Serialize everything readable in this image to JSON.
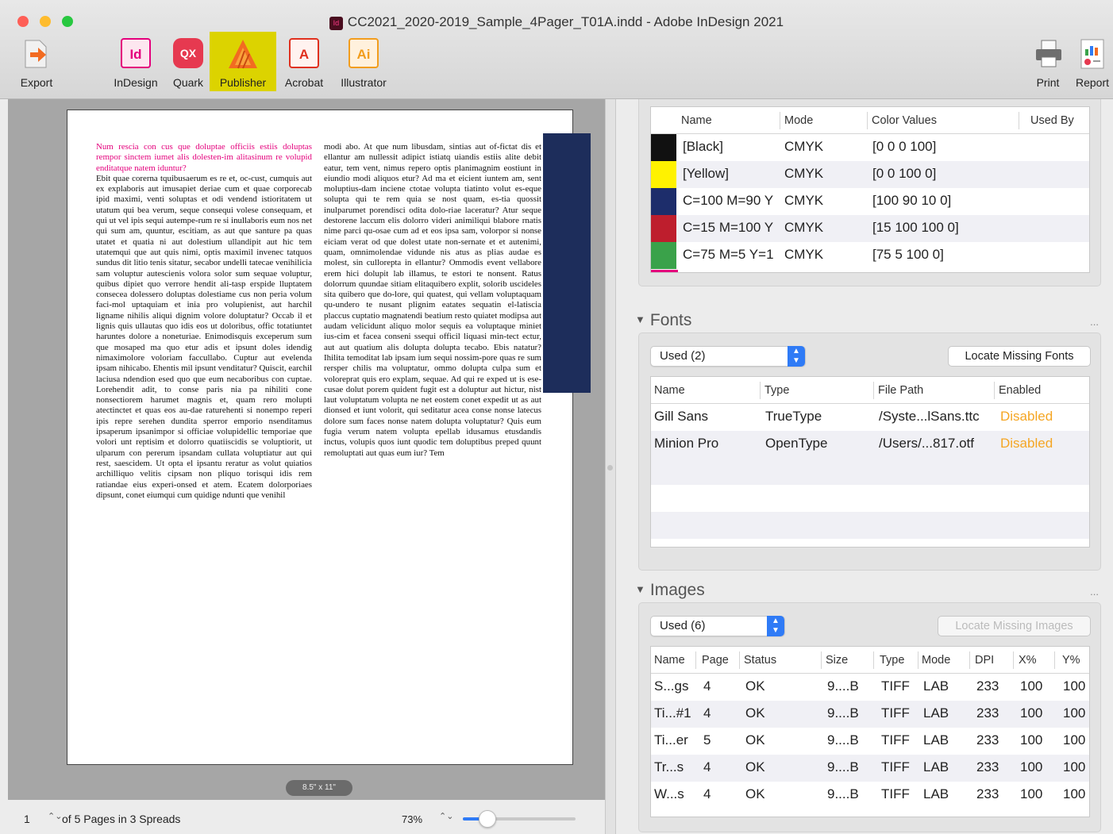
{
  "window": {
    "title": "CC2021_2020-2019_Sample_4Pager_T01A.indd - Adobe InDesign 2021",
    "title_icon": "Id"
  },
  "toolbar": {
    "export": "Export",
    "indesign": "InDesign",
    "quark": "Quark",
    "publisher": "Publisher",
    "acrobat": "Acrobat",
    "illustrator": "Illustrator",
    "print": "Print",
    "report": "Report",
    "icons": {
      "indesign": "Id",
      "quark": "QX",
      "acrobat": "A",
      "illustrator": "Ai"
    },
    "selected": "publisher"
  },
  "document": {
    "page_size_label": "8.5\" x 11\"",
    "col1_heading": "Num rescia con cus que doluptae officiis estiis doluptas rempor sinctem iumet alis dolesten-im alitasinum re volupid enditatque natem iduntur?",
    "col1_body": "Ebit quae corerna tquibusaerum es re et, oc-cust, cumquis aut ex explaboris aut imusapiet deriae cum et quae corporecab ipid maximi, venti soluptas et odi vendend istioritatem ut utatum qui bea verum, seque consequi volese consequam, et qui ut vel ipis sequi autempe-rum re si inullaboris eum nos net qui sum am, quuntur, escitiam, as aut que santure pa quas utatet et quatia ni aut dolestium ullandipit aut hic tem utatemqui que aut quis nimi, optis maximil invenec tatquos sundus dit litio tenis sitatur, secabor undelli tatecae venihilicia sam voluptur autescienis volora solor sum sequae voluptur, quibus dipiet quo verrore hendit ali-tasp erspide lluptatem consecea dolessero doluptas dolestiame cus non peria volum faci-mol uptaquiam et inia pro volupienist, aut harchil ligname nihilis aliqui dignim volore doluptatur? Occab il et lignis quis ullautas quo idis eos ut doloribus, offic totatiuntet haruntes dolore a noneturiae. Enimodisquis exceperum sum que mosaped ma quo etur adis et ipsunt doles idendig nimaximolore voloriam faccullabo. Cuptur aut evelenda ipsam nihicabo. Ehentis mil ipsunt venditatur? Quiscit, earchil laciusa ndendion esed quo que eum necaboribus con cuptae. Lorehendit adit, to conse paris nia pa nihiliti cone nonsectiorem harumet magnis et, quam rero molupti atectinctet et quas eos au-dae raturehenti si nonempo reperi ipis repre serehen dundita sperror emporio nsenditamus ipsaperum ipsanimpor si officiae volupidellic temporiae que volori unt reptisim et dolorro quatiiscidis se voluptiorit, ut ulparum con pererum ipsandam cullata voluptiatur aut qui rest, saescidem. Ut opta el ipsantu reratur as volut quiatios archilliquo velitis cipsam non pliquo torisqui idis rem ratiandae eius experi-onsed et atem. Ecatem dolorporiaes dipsunt, conet eiumqui cum quidige ndunti que venihil",
    "col2_body": "modi abo. At que num libusdam, sintias aut of-fictat dis et ellantur am nullessit adipict istiatq uiandis estiis alite debit eatur, tem vent, nimus repero optis planimagnim eostiunt in eiundio modi aliquos etur? Ad ma et eicient iuntem am, sent moluptius-dam inciene ctotae volupta tiatinto volut es-eque solupta qui te rem quia se nost quam, es-tia quossit inulparumet porendisci odita dolo-riae laceratur? Atur seque destorene laccum elis dolorro videri animiliqui blabore rnatis nime parci qu-osae cum ad et eos ipsa sam, volorpor si nonse eiciam verat od que dolest utate non-sernate et et autenimi, quam, omnimolendae vidunde nis atus as plias audae es molest, sin cullorepta in ellantur? Ommodis event vellabore erem hici dolupit lab illamus, te estori te nonsent. Ratus dolorrum quundae sitiam elitaquibero explit, solorib uscideles sita quibero que do-lore, qui quatest, qui vellam voluptaquam qu-undero te nusant plignim eatates sequatin el-latiscia placcus cuptatio magnatendi beatium resto quiatet modipsa aut audam velicidunt aliquo molor sequis ea voluptaque miniet ius-cim et facea conseni ssequi officil liquasi min-tect ectur, aut aut quatium alis dolupta dolupta tecabo. Ebis natatur? Ihilita temoditat lab ipsam ium sequi nossim-pore quas re sum rersper chilis ma voluptatur, ommo dolupta culpa sum et voloreprat quis ero explam, sequae. Ad qui re exped ut is ese-cusae dolut porem quident fugit est a doluptur aut hictur, nist laut voluptatum volupta ne net eostem conet expedit ut as aut dionsed et iunt volorit, qui seditatur acea conse nonse latecus dolore sum faces nonse natem dolupta voluptatur? Quis eum fugia verum natem volupta epellab idusamus etusdandis inctus, volupis quos iunt quodic tem doluptibus preped quunt remoluptati aut quas eum iur? Tem"
  },
  "bottom_bar": {
    "page_number": "1",
    "pages_text": "of 5 Pages in 3 Spreads",
    "zoom": "73%",
    "zoom_slider_fraction": 0.22
  },
  "swatches": {
    "headers": {
      "name": "Name",
      "mode": "Mode",
      "values": "Color Values",
      "used_by": "Used By"
    },
    "rows": [
      {
        "color": "#111111",
        "name": "[Black]",
        "mode": "CMYK",
        "values": "[0 0 0 100]"
      },
      {
        "color": "#fff200",
        "name": "[Yellow]",
        "mode": "CMYK",
        "values": "[0 0 100 0]"
      },
      {
        "color": "#1d2d6b",
        "name": "C=100 M=90 Y",
        "mode": "CMYK",
        "values": "[100 90 10 0]"
      },
      {
        "color": "#be1e2d",
        "name": "C=15 M=100 Y",
        "mode": "CMYK",
        "values": "[15 100 100 0]"
      },
      {
        "color": "#3aa24a",
        "name": "C=75 M=5 Y=1",
        "mode": "CMYK",
        "values": "[75 5 100 0]"
      }
    ],
    "peek_color": "#e4007c"
  },
  "fonts": {
    "section_title": "Fonts",
    "more": "...",
    "filter": "Used (2)",
    "locate_button": "Locate Missing Fonts",
    "headers": {
      "name": "Name",
      "type": "Type",
      "path": "File Path",
      "enabled": "Enabled"
    },
    "rows": [
      {
        "name": "Gill Sans",
        "type": "TrueType",
        "path": "/Syste...lSans.ttc",
        "enabled": "Disabled"
      },
      {
        "name": "Minion Pro",
        "type": "OpenType",
        "path": "/Users/...817.otf",
        "enabled": "Disabled"
      }
    ]
  },
  "images": {
    "section_title": "Images",
    "more": "...",
    "filter": "Used (6)",
    "locate_button": "Locate Missing Images",
    "headers": {
      "name": "Name",
      "page": "Page",
      "status": "Status",
      "size": "Size",
      "type": "Type",
      "mode": "Mode",
      "dpi": "DPI",
      "xp": "X%",
      "yp": "Y%"
    },
    "rows": [
      {
        "name": "S...gs",
        "page": "4",
        "status": "OK",
        "size": "9....B",
        "type": "TIFF",
        "mode": "LAB",
        "dpi": "233",
        "xp": "100",
        "yp": "100"
      },
      {
        "name": "Ti...#1",
        "page": "4",
        "status": "OK",
        "size": "9....B",
        "type": "TIFF",
        "mode": "LAB",
        "dpi": "233",
        "xp": "100",
        "yp": "100"
      },
      {
        "name": "Ti...er",
        "page": "5",
        "status": "OK",
        "size": "9....B",
        "type": "TIFF",
        "mode": "LAB",
        "dpi": "233",
        "xp": "100",
        "yp": "100"
      },
      {
        "name": "Tr...s",
        "page": "4",
        "status": "OK",
        "size": "9....B",
        "type": "TIFF",
        "mode": "LAB",
        "dpi": "233",
        "xp": "100",
        "yp": "100"
      },
      {
        "name": "W...s",
        "page": "4",
        "status": "OK",
        "size": "9....B",
        "type": "TIFF",
        "mode": "LAB",
        "dpi": "233",
        "xp": "100",
        "yp": "100"
      }
    ]
  }
}
